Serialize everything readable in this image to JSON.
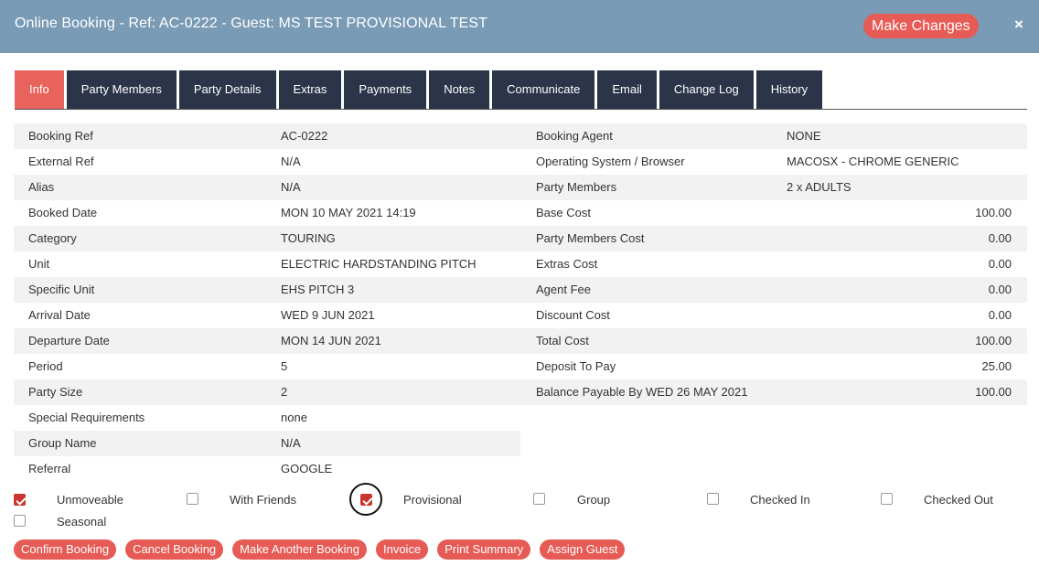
{
  "header": {
    "title": "Online Booking - Ref: AC-0222 - Guest: MS TEST PROVISIONAL TEST",
    "make_changes_label": "Make Changes",
    "close_glyph": "×"
  },
  "tabs": [
    {
      "label": "Info",
      "active": true
    },
    {
      "label": "Party Members",
      "active": false
    },
    {
      "label": "Party Details",
      "active": false
    },
    {
      "label": "Extras",
      "active": false
    },
    {
      "label": "Payments",
      "active": false
    },
    {
      "label": "Notes",
      "active": false
    },
    {
      "label": "Communicate",
      "active": false
    },
    {
      "label": "Email",
      "active": false
    },
    {
      "label": "Change Log",
      "active": false
    },
    {
      "label": "History",
      "active": false
    }
  ],
  "left_details": [
    {
      "label": "Booking Ref",
      "value": "AC-0222"
    },
    {
      "label": "External Ref",
      "value": "N/A"
    },
    {
      "label": "Alias",
      "value": "N/A"
    },
    {
      "label": "Booked Date",
      "value": "MON 10 MAY 2021 14:19"
    },
    {
      "label": "Category",
      "value": "TOURING"
    },
    {
      "label": "Unit",
      "value": "ELECTRIC HARDSTANDING PITCH"
    },
    {
      "label": "Specific Unit",
      "value": "EHS PITCH 3"
    },
    {
      "label": "Arrival Date",
      "value": "WED 9 JUN 2021"
    },
    {
      "label": "Departure Date",
      "value": "MON 14 JUN 2021"
    },
    {
      "label": "Period",
      "value": "5"
    },
    {
      "label": "Party Size",
      "value": "2"
    },
    {
      "label": "Special Requirements",
      "value": "none"
    },
    {
      "label": "Group Name",
      "value": "N/A"
    },
    {
      "label": "Referral",
      "value": "GOOGLE"
    }
  ],
  "right_details": [
    {
      "label": "Booking Agent",
      "value": "NONE"
    },
    {
      "label": "Operating System / Browser",
      "value": "MACOSX - CHROME GENERIC"
    },
    {
      "label": "Party Members",
      "value": "2 x ADULTS"
    }
  ],
  "costs": [
    {
      "label": "Base Cost",
      "value": "100.00"
    },
    {
      "label": "Party Members Cost",
      "value": "0.00"
    },
    {
      "label": "Extras Cost",
      "value": "0.00"
    },
    {
      "label": "Agent Fee",
      "value": "0.00"
    },
    {
      "label": "Discount Cost",
      "value": "0.00"
    },
    {
      "label": "Total Cost",
      "value": "100.00"
    },
    {
      "label": "Deposit To Pay",
      "value": "25.00"
    },
    {
      "label": "Balance Payable By WED 26 MAY 2021",
      "value": "100.00"
    }
  ],
  "flags": [
    {
      "label": "Unmoveable",
      "checked": true
    },
    {
      "label": "With Friends",
      "checked": false
    },
    {
      "label": "Provisional",
      "checked": true
    },
    {
      "label": "Group",
      "checked": false
    },
    {
      "label": "Checked In",
      "checked": false
    },
    {
      "label": "Checked Out",
      "checked": false
    },
    {
      "label": "Seasonal",
      "checked": false
    }
  ],
  "actions": [
    {
      "label": "Confirm Booking"
    },
    {
      "label": "Cancel Booking"
    },
    {
      "label": "Make Another Booking"
    },
    {
      "label": "Invoice"
    },
    {
      "label": "Print Summary"
    },
    {
      "label": "Assign Guest"
    }
  ]
}
